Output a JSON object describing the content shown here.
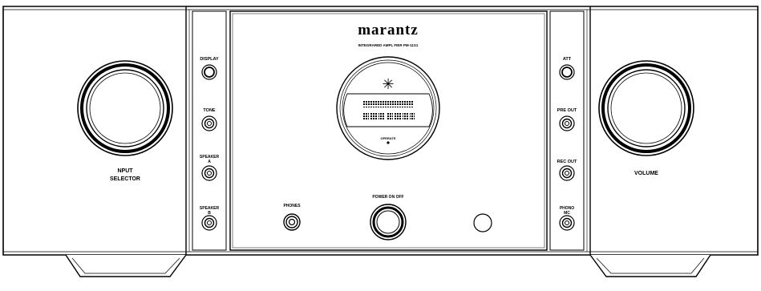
{
  "brand": "marantz",
  "model_label": "INTEGRARED AMPL FIER PM-11S1",
  "left_knob_label": {
    "line1": "NPUT",
    "line2": "SELECTOR"
  },
  "right_knob_label": "VOLUME",
  "left_buttons": [
    {
      "line1": "DISPLAY",
      "line2": ""
    },
    {
      "line1": "TONE",
      "line2": ""
    },
    {
      "line1": "SPEAKER",
      "line2": "A"
    },
    {
      "line1": "SPEAKER",
      "line2": "B"
    }
  ],
  "right_buttons": [
    {
      "line1": "ATT",
      "line2": ""
    },
    {
      "line1": "PRE OUT",
      "line2": ""
    },
    {
      "line1": "REC OUT",
      "line2": ""
    },
    {
      "line1": "PHONO",
      "line2": "MC"
    }
  ],
  "operate_label": "OPERATE",
  "phones_label": "PHONES",
  "power_label": "POWER ON OFF",
  "logo_symbol": "✳"
}
